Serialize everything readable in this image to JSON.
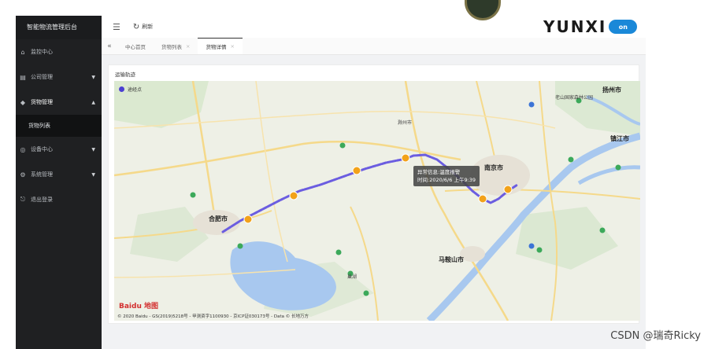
{
  "app": {
    "title": "智能物流管理后台"
  },
  "sidebar": {
    "items": [
      {
        "label": "监控中心",
        "icon": "home-icon",
        "has_arrow": false
      },
      {
        "label": "公司管理",
        "icon": "building-icon",
        "has_arrow": true,
        "arrow": "▼"
      },
      {
        "label": "货物管理",
        "icon": "box-icon",
        "has_arrow": true,
        "arrow": "▲",
        "active": true
      },
      {
        "label": "货物列表",
        "sub": true
      },
      {
        "label": "设备中心",
        "icon": "device-icon",
        "has_arrow": true,
        "arrow": "▼"
      },
      {
        "label": "系统管理",
        "icon": "gear-icon",
        "has_arrow": true,
        "arrow": "▼"
      },
      {
        "label": "退出登录",
        "icon": "logout-icon",
        "has_arrow": false
      }
    ]
  },
  "header": {
    "refresh_label": "刷新",
    "brand_text": "YUNXI",
    "brand_badge": "on"
  },
  "tabs": {
    "back_icon": "«",
    "items": [
      {
        "label": "中心首页",
        "closable": false
      },
      {
        "label": "货物列表",
        "closable": true
      },
      {
        "label": "货物详情",
        "closable": true,
        "active": true
      }
    ]
  },
  "panel": {
    "title": "运输轨迹",
    "legend": "途经点",
    "tooltip": {
      "line1": "异常信息:温度报警",
      "line2": "时间:2020/6/6 上午9:39"
    },
    "map_labels": {
      "cities": [
        "合肥市",
        "南京市",
        "马鞍山市",
        "滁州市",
        "扬州市",
        "镇江市"
      ],
      "places": [
        "巢湖",
        "老山国家森林公园"
      ]
    },
    "attribution": "© 2020 Baidu - GS(2019)5218号 - 甲测资字1100930 - 京ICP证030173号 - Data © 长地万方",
    "baidu_logo": "Bai",
    "baidu_logo_suffix": "du 地图"
  },
  "watermark": "CSDN @瑞奇Ricky",
  "colors": {
    "sidebar_bg": "#1f2022",
    "route": "#6b5de0",
    "marker": "#f2a21a",
    "tooltip_bg": "#464646",
    "brand_badge": "#1a88d8"
  }
}
